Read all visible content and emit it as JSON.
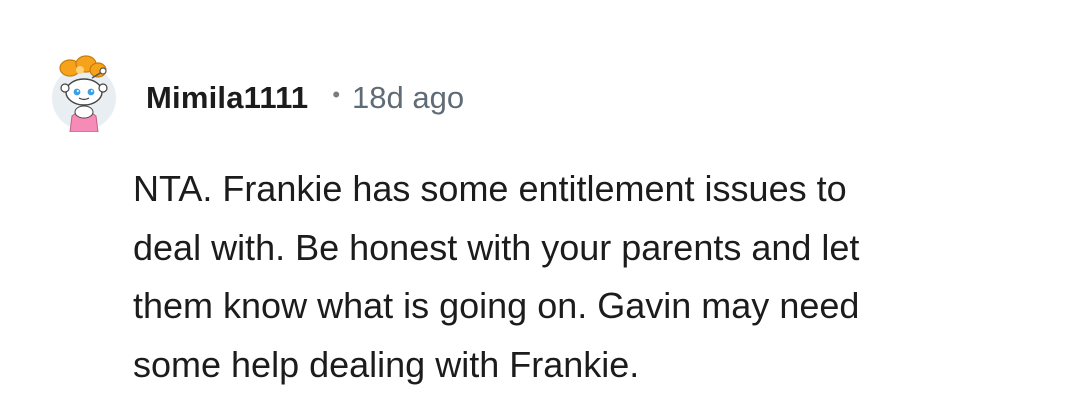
{
  "comment": {
    "author": "Mimila1111",
    "separator": "•",
    "timestamp": "18d ago",
    "avatar_icon": "snoo-avatar-icon",
    "lines": [
      "NTA. Frankie has some entitlement issues to",
      "deal with. Be honest with your parents and let",
      "them know what is going on. Gavin may need",
      "some help dealing with Frankie."
    ]
  },
  "colors": {
    "text": "#1c1c1c",
    "meta": "#5f6b76",
    "avatar_bg": "#e9eef2",
    "bow": "#f7a21b",
    "shirt": "#f58bb6"
  }
}
